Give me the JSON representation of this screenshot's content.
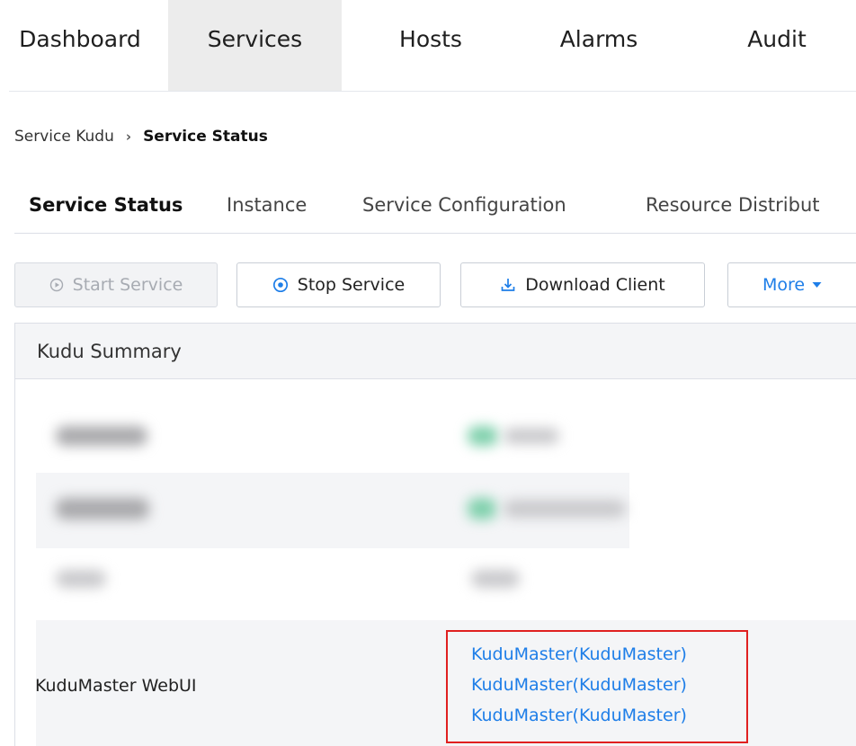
{
  "topnav": {
    "items": [
      {
        "label": "Dashboard"
      },
      {
        "label": "Services"
      },
      {
        "label": "Hosts"
      },
      {
        "label": "Alarms"
      },
      {
        "label": "Audit"
      }
    ],
    "active_item": "Services"
  },
  "breadcrumb": {
    "parent": "Service Kudu",
    "separator": "›",
    "current": "Service Status"
  },
  "tabs": {
    "items": [
      {
        "label": "Service Status"
      },
      {
        "label": "Instance"
      },
      {
        "label": "Service Configuration"
      },
      {
        "label": "Resource Distribut"
      }
    ],
    "active_tab": "Service Status"
  },
  "toolbar": {
    "start_label": "Start Service",
    "stop_label": "Stop Service",
    "download_label": "Download Client",
    "more_label": "More"
  },
  "panel": {
    "title": "Kudu Summary",
    "webui_label": "KuduMaster WebUI",
    "webui_links": [
      "KuduMaster(KuduMaster)",
      "KuduMaster(KuduMaster)",
      "KuduMaster(KuduMaster)"
    ]
  },
  "colors": {
    "accent": "#1e7ee8",
    "highlight_border": "#e02020",
    "active_nav_bg": "#ececec",
    "panel_header_bg": "#f4f5f7"
  },
  "icons": {
    "start": "play-circle-icon",
    "stop": "stop-circle-icon",
    "download": "download-icon",
    "more": "caret-down-icon"
  }
}
